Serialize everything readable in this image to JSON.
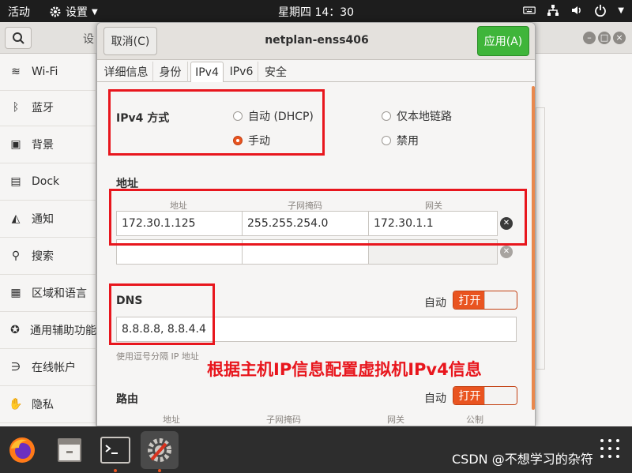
{
  "topbar": {
    "activities": "活动",
    "app_name": "设置",
    "clock": "星期四 14：30",
    "tray_icons": [
      "keyboard-icon",
      "network-icon",
      "volume-icon",
      "power-icon"
    ]
  },
  "settings": {
    "title_fragment": "设",
    "sidebar": [
      {
        "icon": "wifi-icon",
        "label": "Wi-Fi"
      },
      {
        "icon": "bluetooth-icon",
        "label": "蓝牙"
      },
      {
        "icon": "background-icon",
        "label": "背景"
      },
      {
        "icon": "dock-icon",
        "label": "Dock"
      },
      {
        "icon": "bell-icon",
        "label": "通知"
      },
      {
        "icon": "search-icon",
        "label": "搜索"
      },
      {
        "icon": "region-icon",
        "label": "区域和语言"
      },
      {
        "icon": "accessibility-icon",
        "label": "通用辅助功能"
      },
      {
        "icon": "online-accounts-icon",
        "label": "在线帐户"
      },
      {
        "icon": "privacy-icon",
        "label": "隐私"
      }
    ]
  },
  "dialog": {
    "cancel_label": "取消(C)",
    "title": "netplan-enss406",
    "apply_label": "应用(A)",
    "tabs": [
      "详细信息",
      "身份",
      "IPv4",
      "IPv6",
      "安全"
    ],
    "active_tab": "IPv4",
    "ipv4_method": {
      "label": "IPv4 方式",
      "options": [
        {
          "label": "自动 (DHCP)",
          "checked": false
        },
        {
          "label": "仅本地链路",
          "checked": false
        },
        {
          "label": "手动",
          "checked": true
        },
        {
          "label": "禁用",
          "checked": false
        }
      ]
    },
    "addresses": {
      "label": "地址",
      "columns": [
        "地址",
        "子网掩码",
        "网关"
      ],
      "rows": [
        [
          "172.30.1.125",
          "255.255.254.0",
          "172.30.1.1"
        ],
        [
          "",
          "",
          ""
        ]
      ]
    },
    "dns": {
      "label": "DNS",
      "auto_label": "自动",
      "switch_label": "打开",
      "value": "8.8.8.8, 8.8.4.4",
      "hint": "使用逗号分隔 IP 地址"
    },
    "routes": {
      "label": "路由",
      "auto_label": "自动",
      "switch_label": "打开",
      "columns": [
        "地址",
        "子网掩码",
        "网关",
        "公制"
      ]
    }
  },
  "annotation": "根据主机IP信息配置虚拟机IPv4信息",
  "dock": {
    "apps": [
      "firefox-icon",
      "files-icon",
      "terminal-icon",
      "settings-icon"
    ],
    "show_apps_icon": "grid-icon"
  },
  "watermark": "CSDN @不想学习的杂符",
  "colors": {
    "accent": "#e95420",
    "apply": "#3fb53a",
    "annotation": "#e8161d"
  }
}
